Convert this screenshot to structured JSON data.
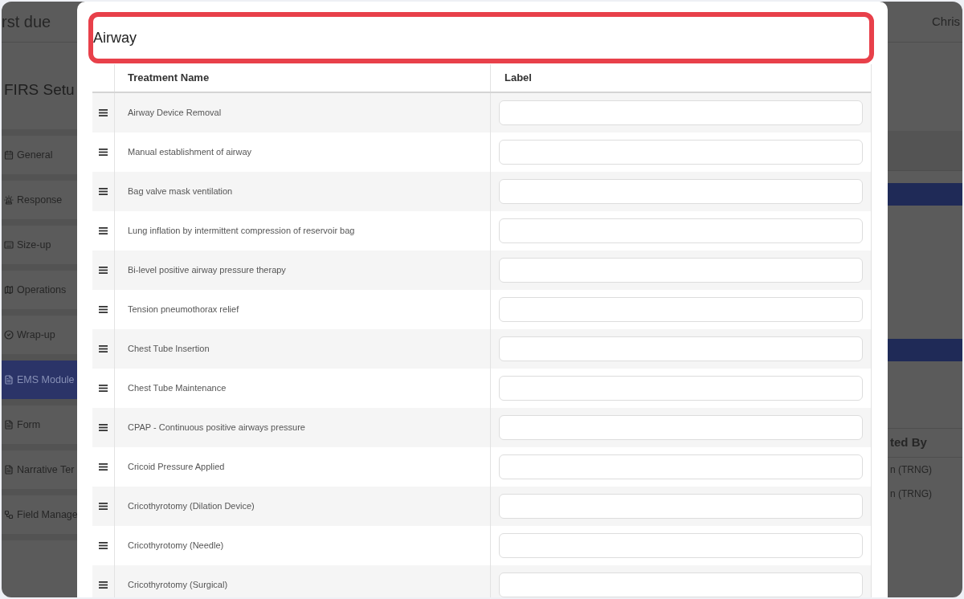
{
  "app": {
    "brand": "rst due",
    "user": "Chris",
    "page_title": "FIRS Setu",
    "sidebar": {
      "items": [
        {
          "label": "General",
          "selected": false
        },
        {
          "label": "Response",
          "selected": false
        },
        {
          "label": "Size-up",
          "selected": false
        },
        {
          "label": "Operations",
          "selected": false
        },
        {
          "label": "Wrap-up",
          "selected": false
        },
        {
          "label": "EMS Module",
          "selected": true
        },
        {
          "label": "Form",
          "selected": false
        },
        {
          "label": "Narrative Ter",
          "selected": false
        },
        {
          "label": "Field Manage",
          "selected": false
        }
      ]
    },
    "table": {
      "column_header": "ted By",
      "rows": [
        "n (TRNG)",
        "n (TRNG)"
      ]
    }
  },
  "modal": {
    "title": "Airway",
    "title_highlighted": true,
    "columns": [
      "Treatment Name",
      "Label"
    ],
    "rows": [
      {
        "treatment_name": "Airway Device Removal"
      },
      {
        "treatment_name": "Manual establishment of airway"
      },
      {
        "treatment_name": "Bag valve mask ventilation"
      },
      {
        "treatment_name": "Lung inflation by intermittent compression of reservoir bag"
      },
      {
        "treatment_name": "Bi-level positive airway pressure therapy"
      },
      {
        "treatment_name": "Tension pneumothorax relief"
      },
      {
        "treatment_name": "Chest Tube Insertion"
      },
      {
        "treatment_name": "Chest Tube Maintenance"
      },
      {
        "treatment_name": "CPAP - Continuous positive airways pressure"
      },
      {
        "treatment_name": "Cricoid Pressure Applied"
      },
      {
        "treatment_name": "Cricothyrotomy (Dilation Device)"
      },
      {
        "treatment_name": "Cricothyrotomy (Needle)"
      },
      {
        "treatment_name": "Cricothyrotomy (Surgical)"
      }
    ]
  }
}
